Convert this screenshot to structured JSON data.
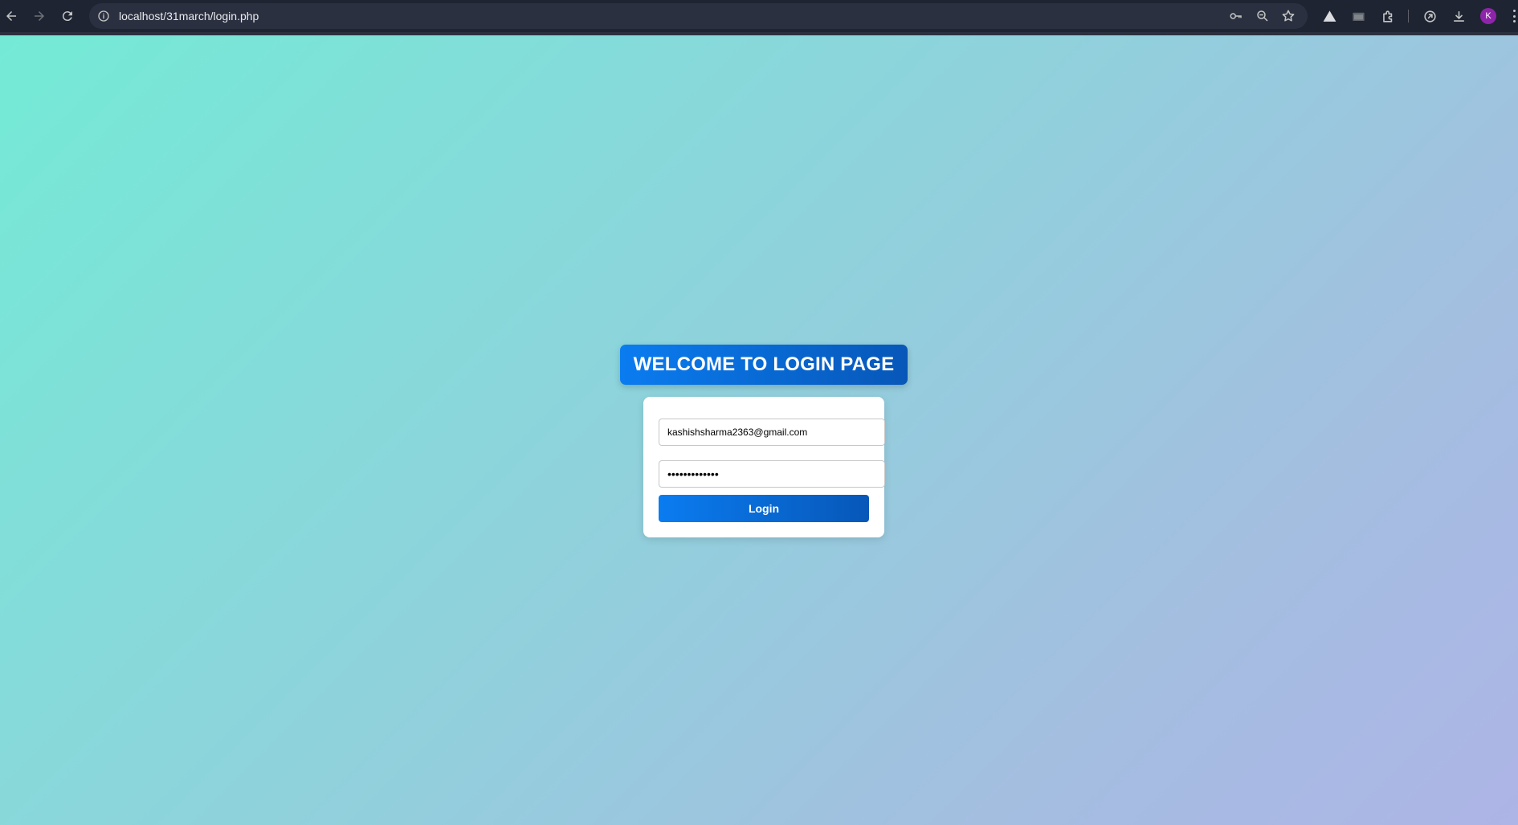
{
  "browser": {
    "url": "localhost/31march/login.php",
    "profile_initial": "K",
    "icons": {
      "back": "back-arrow-icon",
      "forward": "forward-arrow-icon",
      "reload": "reload-icon",
      "site_info": "info-icon",
      "password_key": "key-icon",
      "zoom": "zoom-icon",
      "bookmark": "star-icon",
      "extensions": [
        "triangle-extension-icon",
        "folder-extension-icon",
        "puzzle-icon",
        "sync-icon",
        "download-icon"
      ],
      "menu": "more-vert-icon"
    }
  },
  "page": {
    "heading": "WELCOME TO LOGIN PAGE",
    "email_value": "kashishsharma2363@gmail.com",
    "password_value": "•••••••••••••",
    "login_label": "Login"
  },
  "colors": {
    "accent_start": "#0a7cf0",
    "accent_end": "#0757b8",
    "background_start": "#74ead6",
    "background_end": "#adb4e6"
  }
}
